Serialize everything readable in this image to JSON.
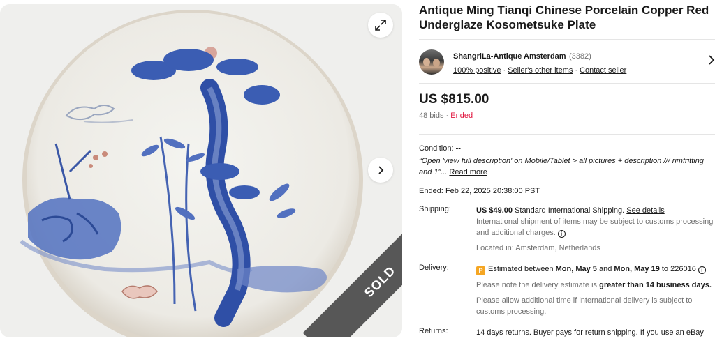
{
  "gallery": {
    "sold_label": "SOLD",
    "icons": {
      "expand": "expand-icon",
      "next": "chevron-right-icon"
    }
  },
  "listing": {
    "title": "Antique Ming Tianqi Chinese Porcelain Copper Red Underglaze Kosometsuke Plate"
  },
  "seller": {
    "name": "ShangriLa-Antique Amsterdam",
    "count": "(3382)",
    "positive": "100% positive",
    "other_items": "Seller's other items",
    "contact": "Contact seller",
    "separator": "·"
  },
  "price": {
    "amount": "US $815.00",
    "bids": "48 bids",
    "separator": "·",
    "status": "Ended"
  },
  "condition": {
    "label": "Condition:",
    "value": "--",
    "quote": "“Open 'view full description' on Mobile/Tablet > all pictures + description /// rimfritting and 1”...",
    "read_more": "Read more"
  },
  "ended": {
    "label": "Ended:",
    "value": "Feb 22, 2025 20:38:00 PST"
  },
  "shipping": {
    "label": "Shipping:",
    "cost": "US $49.00",
    "method": "Standard International Shipping.",
    "details_link": "See details",
    "note": "International shipment of items may be subject to customs processing and additional charges.",
    "location": "Located in: Amsterdam, Netherlands"
  },
  "delivery": {
    "label": "Delivery:",
    "badge": "P",
    "prefix": "Estimated between",
    "date_from": "Mon, May 5",
    "and": "and",
    "date_to": "Mon, May 19",
    "to_word": "to",
    "postcode": "226016",
    "note1_prefix": "Please note the delivery estimate is",
    "note1_bold": "greater than 14 business days.",
    "note2": "Please allow additional time if international delivery is subject to customs processing."
  },
  "returns": {
    "label": "Returns:",
    "text": "14 days returns. Buyer pays for return shipping. If you use an eBay"
  },
  "colors": {
    "ended_red": "#e0103a",
    "sold_band": "#575757",
    "accent_badge": "#f5a623",
    "cobalt": "#3f5fae"
  }
}
